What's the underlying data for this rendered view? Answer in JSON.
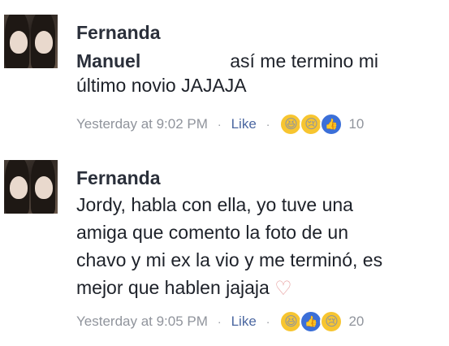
{
  "comments": [
    {
      "author": "Fernanda",
      "tagged": "Manuel",
      "text_line1_rest": "así me termino mi",
      "text_line2": "último novio JAJAJA",
      "time": "Yesterday at 9:02 PM",
      "like_label": "Like",
      "separator": "·",
      "reactions": [
        "haha",
        "sad",
        "like"
      ],
      "reaction_count": "10"
    },
    {
      "author": "Fernanda",
      "text_lines": [
        "Jordy, habla con ella, yo tuve una",
        "amiga que comento la foto de un",
        "chavo y mi ex la vio y me terminó, es",
        "mejor que hablen jajaja"
      ],
      "heart_icon": "heart-outline-icon",
      "time": "Yesterday at 9:05 PM",
      "like_label": "Like",
      "separator": "·",
      "reactions": [
        "haha",
        "like",
        "sad"
      ],
      "reaction_count": "20"
    }
  ]
}
